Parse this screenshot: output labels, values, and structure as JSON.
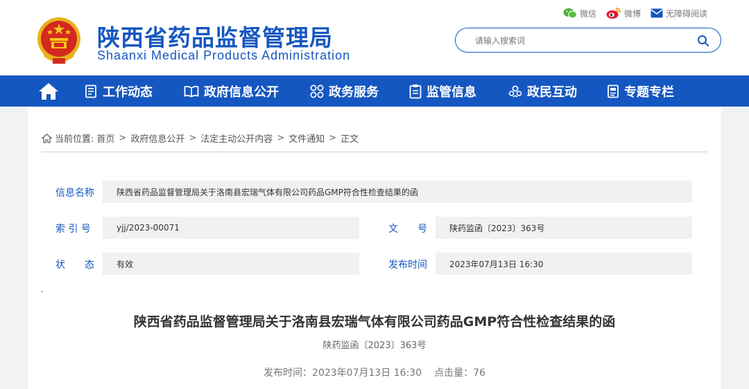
{
  "site": {
    "title_cn": "陕西省药品监督管理局",
    "title_en": "Shaanxi Medical Products Administration"
  },
  "top_links": {
    "wechat": "微信",
    "weibo": "微博",
    "accessibility": "无障碍阅读"
  },
  "search": {
    "placeholder": "请输入搜索词"
  },
  "nav": {
    "items": [
      {
        "label": "工作动态",
        "icon": "document-list-icon"
      },
      {
        "label": "政府信息公开",
        "icon": "open-book-icon"
      },
      {
        "label": "政务服务",
        "icon": "grid-circles-icon"
      },
      {
        "label": "监管信息",
        "icon": "clipboard-icon"
      },
      {
        "label": "政民互动",
        "icon": "people-interaction-icon"
      },
      {
        "label": "专题专栏",
        "icon": "notebook-icon"
      }
    ]
  },
  "breadcrumb": {
    "prefix": "当前位置:",
    "items": [
      "首页",
      "政府信息公开",
      "法定主动公开内容",
      "文件通知"
    ],
    "current": "正文"
  },
  "info": {
    "name_label": "信息名称",
    "name_value": "陕西省药品监督管理局关于洛南县宏瑞气体有限公司药品GMP符合性检查结果的函",
    "index_label": "索 引 号",
    "index_value": "yjj/2023-00071",
    "docno_label": "文　　号",
    "docno_value": "陕药监函〔2023〕363号",
    "status_label": "状　　态",
    "status_value": "有效",
    "date_label": "发布时间",
    "date_value": "2023年07月13日 16:30"
  },
  "article": {
    "dot": ".",
    "title": "陕西省药品监督管理局关于洛南县宏瑞气体有限公司药品GMP符合性检查结果的函",
    "doc_number": "陕药监函〔2023〕363号",
    "publish_label": "发布时间：",
    "publish_time": "2023年07月13日 16:30",
    "hits_label": "点击量：",
    "hits": "76"
  },
  "colors": {
    "brand_blue": "#1557c0",
    "page_bg": "#f1f2f4"
  }
}
